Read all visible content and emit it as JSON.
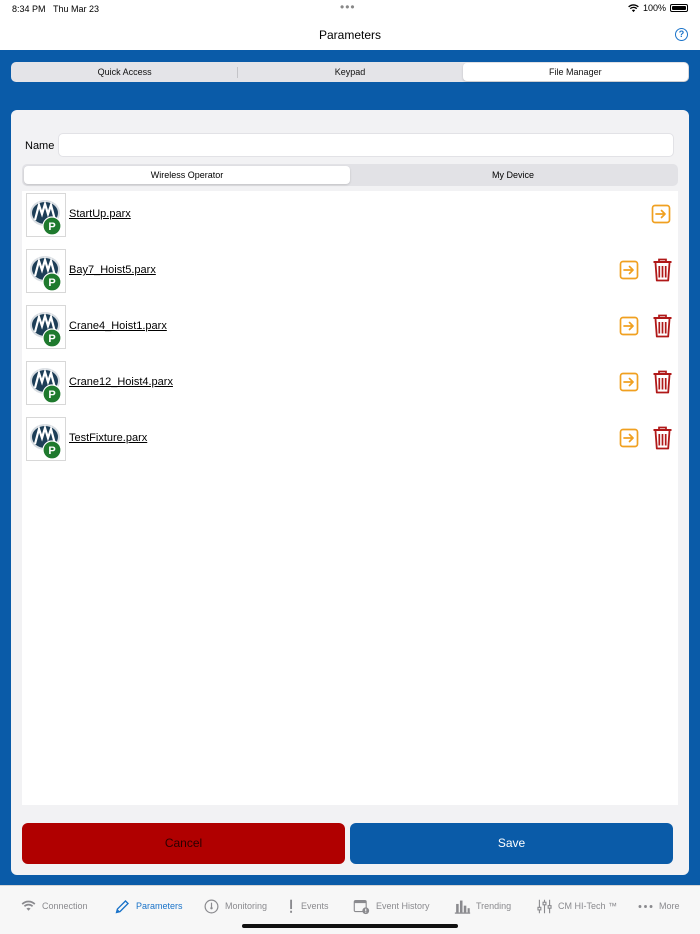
{
  "status_bar": {
    "time": "8:34 PM",
    "date": "Thu Mar 23",
    "battery": "100%"
  },
  "header": {
    "title": "Parameters"
  },
  "top_tabs": [
    {
      "label": "Quick Access",
      "active": false
    },
    {
      "label": "Keypad",
      "active": false
    },
    {
      "label": "File Manager",
      "active": true
    }
  ],
  "form": {
    "name_label": "Name",
    "name_value": "",
    "name_placeholder": ""
  },
  "source_tabs": [
    {
      "label": "Wireless Operator",
      "active": true
    },
    {
      "label": "My Device",
      "active": false
    }
  ],
  "files": [
    {
      "name": "StartUp.parx",
      "deletable": false
    },
    {
      "name": "Bay7_Hoist5.parx",
      "deletable": true
    },
    {
      "name": "Crane4_Hoist1.parx",
      "deletable": true
    },
    {
      "name": "Crane12_Hoist4.parx",
      "deletable": true
    },
    {
      "name": "TestFixture.parx",
      "deletable": true
    }
  ],
  "buttons": {
    "cancel": "Cancel",
    "save": "Save"
  },
  "tab_bar": [
    {
      "label": "Connection",
      "icon": "wifi-icon",
      "active": false
    },
    {
      "label": "Parameters",
      "icon": "pencil-icon",
      "active": true
    },
    {
      "label": "Monitoring",
      "icon": "gauge-icon",
      "active": false
    },
    {
      "label": "Events",
      "icon": "exclamation-icon",
      "active": false
    },
    {
      "label": "Event History",
      "icon": "calendar-alert-icon",
      "active": false
    },
    {
      "label": "Trending",
      "icon": "bar-chart-icon",
      "active": false
    },
    {
      "label": "CM HI-Tech ™",
      "icon": "sliders-icon",
      "active": false
    },
    {
      "label": "More",
      "icon": "more-dots-icon",
      "active": false
    }
  ],
  "colors": {
    "brand_blue": "#0a5ba8",
    "cancel_red": "#b00000",
    "export_orange": "#f0a020",
    "trash_red": "#b01818",
    "active_tab": "#1a73c9"
  }
}
